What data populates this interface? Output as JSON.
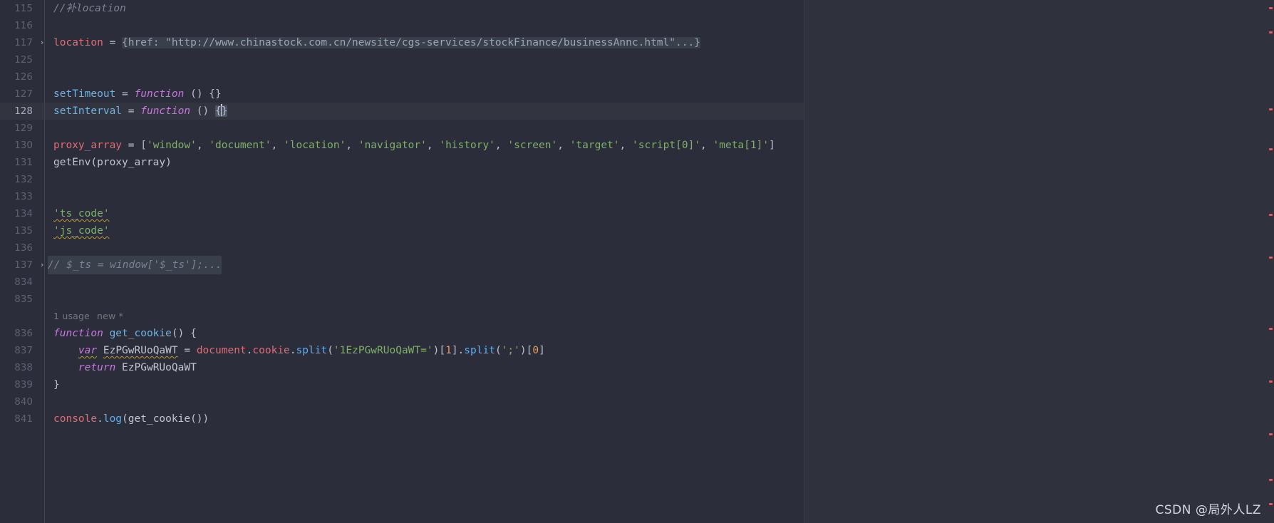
{
  "editor": {
    "theme_background": "#2b2d3a",
    "current_line_number": 128,
    "lines": [
      {
        "num": "115",
        "fold": "",
        "kind": "comment",
        "text": "//补location"
      },
      {
        "num": "116",
        "fold": "",
        "kind": "blank",
        "text": ""
      },
      {
        "num": "117",
        "fold": "chevron-right",
        "kind": "assign-object",
        "name": "location",
        "op": " = ",
        "value": "{href: \"http://www.chinastock.com.cn/newsite/cgs-services/stockFinance/businessAnnc.html\"...}"
      },
      {
        "num": "125",
        "fold": "",
        "kind": "blank",
        "text": ""
      },
      {
        "num": "126",
        "fold": "",
        "kind": "blank",
        "text": ""
      },
      {
        "num": "127",
        "fold": "",
        "kind": "fn-assign",
        "name": "setTimeout",
        "op": " = ",
        "kw": "function",
        "tail": " () {}"
      },
      {
        "num": "128",
        "fold": "",
        "kind": "fn-assign-caret",
        "name": "setInterval",
        "op": " = ",
        "kw": "function",
        "tail": " () ",
        "brace_open": "{",
        "brace_close": "}"
      },
      {
        "num": "129",
        "fold": "",
        "kind": "blank",
        "text": ""
      },
      {
        "num": "130",
        "fold": "",
        "kind": "array-assign",
        "name": "proxy_array",
        "op": " = ",
        "items": [
          "'window'",
          "'document'",
          "'location'",
          "'navigator'",
          "'history'",
          "'screen'",
          "'target'",
          "'script[0]'",
          "'meta[1]'"
        ]
      },
      {
        "num": "131",
        "fold": "",
        "kind": "call",
        "text": "getEnv(proxy_array)"
      },
      {
        "num": "132",
        "fold": "",
        "kind": "blank",
        "text": ""
      },
      {
        "num": "133",
        "fold": "",
        "kind": "blank",
        "text": ""
      },
      {
        "num": "134",
        "fold": "",
        "kind": "string-stmt",
        "text": "'ts_code'"
      },
      {
        "num": "135",
        "fold": "",
        "kind": "string-stmt",
        "text": "'js_code'"
      },
      {
        "num": "136",
        "fold": "",
        "kind": "blank",
        "text": ""
      },
      {
        "num": "137",
        "fold": "chevron-right",
        "kind": "folded-comment",
        "text": "// $_ts = window['$_ts'];..."
      },
      {
        "num": "834",
        "fold": "",
        "kind": "blank",
        "text": ""
      },
      {
        "num": "835",
        "fold": "",
        "kind": "blank",
        "text": ""
      },
      {
        "num": "",
        "fold": "",
        "kind": "inlay",
        "usage": "1 usage",
        "new_marker": "new *"
      },
      {
        "num": "836",
        "fold": "",
        "kind": "fn-decl",
        "kw": "function",
        "name": "get_cookie",
        "tail": "() {"
      },
      {
        "num": "837",
        "fold": "",
        "kind": "var-decl",
        "kw": "var",
        "var_name": "EzPGwRUoQaWT",
        "op": " = ",
        "obj": "document",
        "dot1": ".",
        "prop": "cookie",
        "dot2": ".",
        "m1": "split",
        "a1": "'1EzPGwRUoQaWT='",
        "idx": "1",
        "m2": "split",
        "a2": "';'",
        "idx2": "0"
      },
      {
        "num": "838",
        "fold": "",
        "kind": "return-stmt",
        "kw": "return",
        "value": "EzPGwRUoQaWT"
      },
      {
        "num": "839",
        "fold": "",
        "kind": "brace-close",
        "text": "}"
      },
      {
        "num": "840",
        "fold": "",
        "kind": "blank",
        "text": ""
      },
      {
        "num": "841",
        "fold": "",
        "kind": "console-log",
        "obj": "console",
        "dot": ".",
        "method": "log",
        "open": "(",
        "arg": "get_cookie()",
        "close": ")"
      }
    ],
    "fold_icon": "›"
  },
  "markers": {
    "color": "#d16060",
    "positions_pct": [
      1.5,
      6,
      21,
      28.5,
      41,
      49,
      63,
      73,
      83,
      92,
      96
    ]
  },
  "watermark": {
    "text": "CSDN @局外人LZ"
  },
  "colors": {
    "background": "#2b2d3a",
    "right_pane": "#2f313d",
    "current_line": "#32343f",
    "line_number": "#5c6370",
    "keyword": "#c678dd",
    "string": "#7fb069",
    "identifier_red": "#e06c75",
    "identifier_blue": "#6eb4e0",
    "comment": "#7a8290",
    "number": "#e59a5a",
    "warning_squiggle": "#b89b4a"
  }
}
